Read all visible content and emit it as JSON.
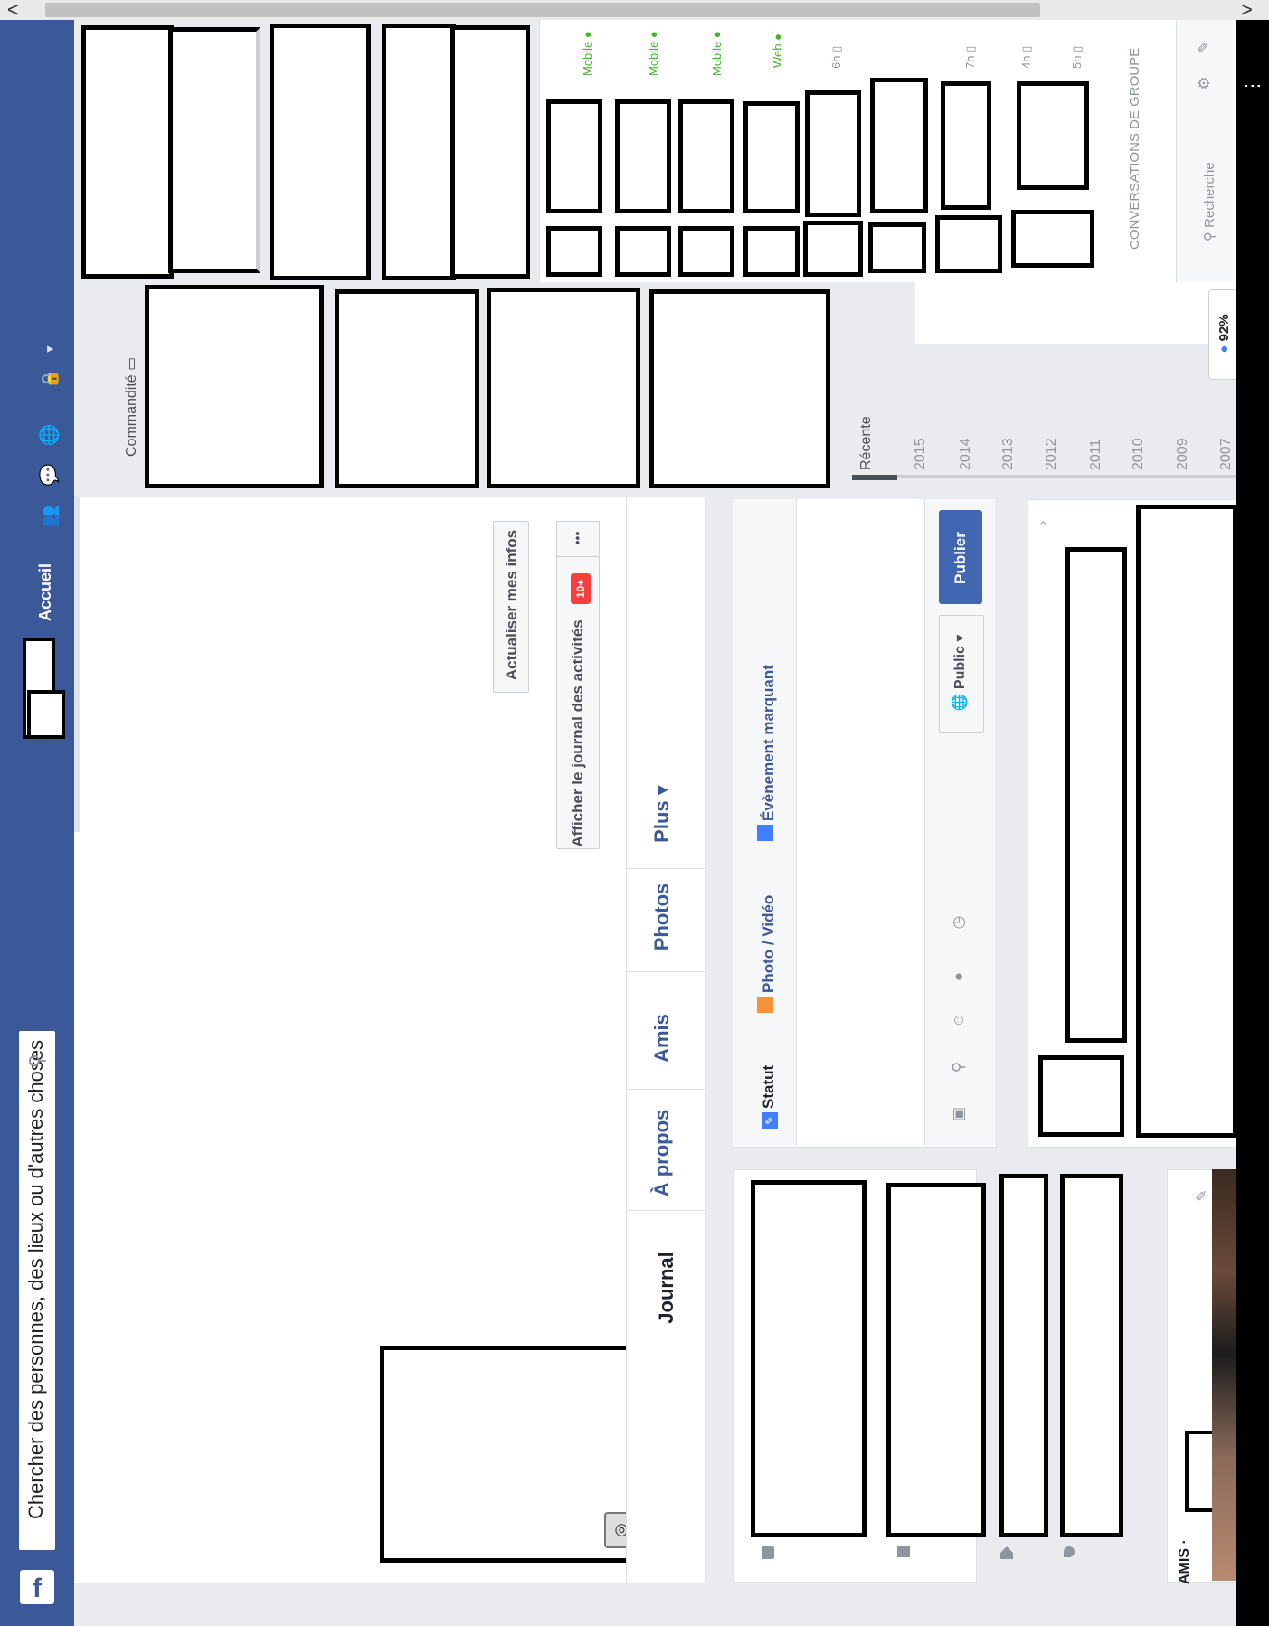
{
  "search": {
    "placeholder": "Chercher des personnes, des lieux ou d'autres choses"
  },
  "header": {
    "home_label": "Accueil",
    "scroll_left": "<",
    "scroll_right": ">"
  },
  "profile": {
    "update_info": "Actualiser mes infos",
    "activity_log": "Afficher le journal des activités",
    "activity_badge": "10+",
    "more_dots": "•••",
    "tabs": [
      "Journal",
      "À propos",
      "Amis",
      "Photos",
      "Plus ▾"
    ]
  },
  "composer": {
    "status": "Statut",
    "photo_video": "Photo / Vidéo",
    "life_event": "Évènement marquant",
    "audience": "Public ▾",
    "publish": "Publier"
  },
  "friends_section": {
    "label": "AMIS ·"
  },
  "sponsored": {
    "label": "Commandité"
  },
  "timeline_years": [
    "Récente",
    "2015",
    "2014",
    "2013",
    "2012",
    "2011",
    "2010",
    "2009",
    "2007"
  ],
  "chat": {
    "statuses": [
      "Mobile",
      "Mobile",
      "Mobile",
      "Web",
      "6h",
      "",
      "7h",
      "4h",
      "5h"
    ],
    "group_conversations": "CONVERSATIONS DE GROUPE",
    "search_placeholder": "Recherche",
    "battery": "92%"
  },
  "colors": {
    "brand": "#3b5998",
    "online": "#42b72a",
    "badge": "#fa3e3e"
  }
}
